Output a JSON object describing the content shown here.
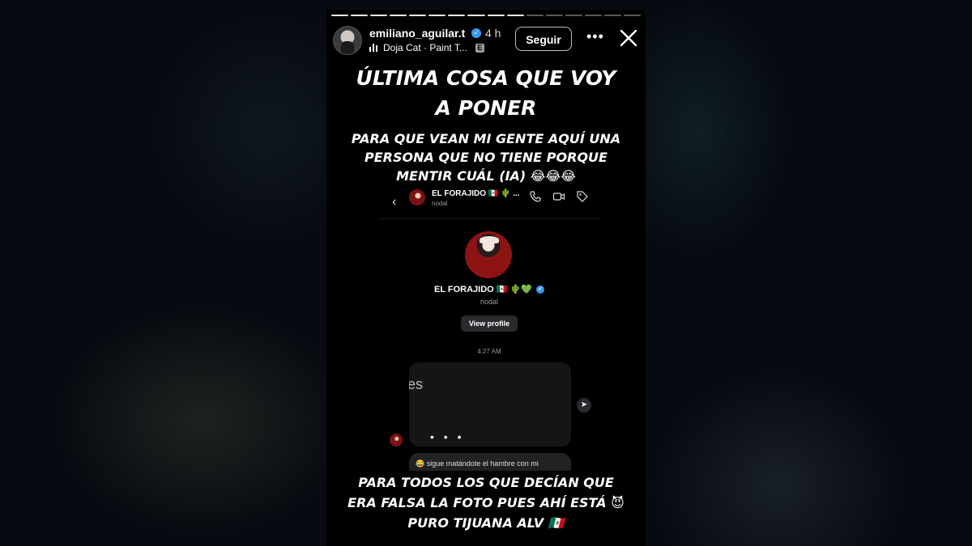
{
  "story": {
    "progress_segments_total": 16,
    "progress_segments_done": 10,
    "header": {
      "username": "emiliano_aguilar.t",
      "time": "4 h",
      "music": "Doja Cat · Paint T...",
      "explicit_badge": "E",
      "follow_label": "Seguir",
      "more_icon": "more-horizontal-icon",
      "close_icon": "close-icon"
    },
    "caption_top_line1": "ÚLTIMA COSA QUE VOY",
    "caption_top_line2": "A PONER",
    "caption_mid_line1": "PARA QUE VEAN MI GENTE AQUÍ UNA",
    "caption_mid_line2": "PERSONA QUE NO TIENE PORQUE",
    "caption_mid_line3": "MENTIR CUÁL (IA) 😂😂😂",
    "caption_bottom_line1": "PARA TODOS LOS QUE DECÍAN QUE",
    "caption_bottom_line2": "ERA FALSA LA FOTO PUES AHÍ ESTÁ 😈",
    "caption_bottom_line3": "PURO TIJUANA ALV 🇲🇽"
  },
  "dm": {
    "contact_name": "EL FORAJIDO 🇲🇽 🌵 ...",
    "contact_sub": "nodal",
    "profile_name": "EL FORAJIDO 🇲🇽 🌵💚",
    "profile_sub": "nodal",
    "view_profile_label": "View profile",
    "timestamp": "4:27 AM",
    "media_text": "es",
    "typing_dots": "• • •",
    "reply_text": "😂 sigue matándote  el hambre con mi"
  }
}
